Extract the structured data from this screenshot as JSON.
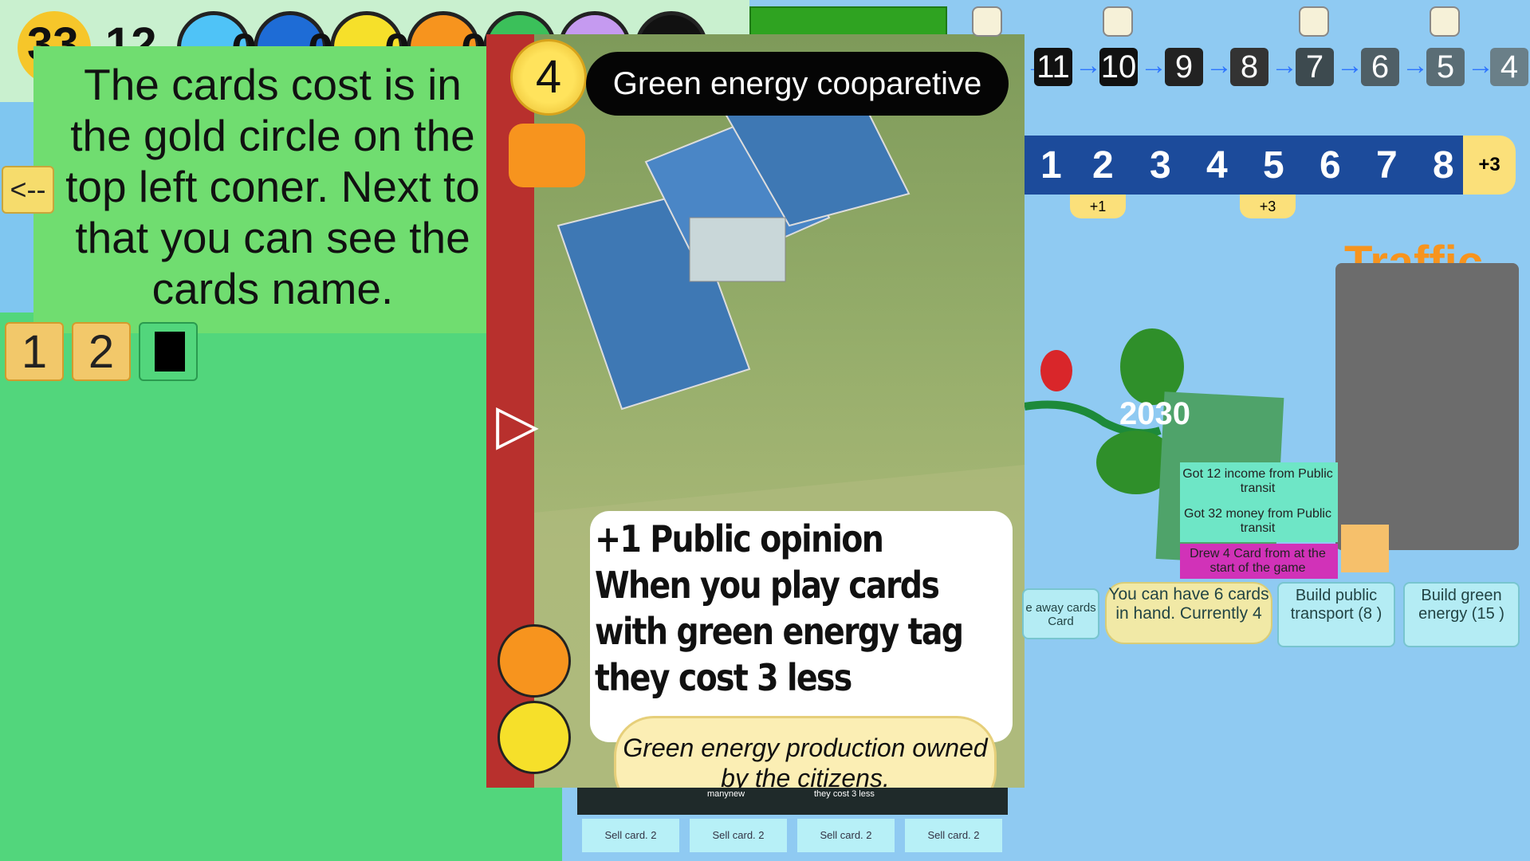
{
  "top_resources": {
    "score": "33",
    "money": "12",
    "zero1": "0",
    "zero2": "0",
    "zero3": "0",
    "zero4": "0"
  },
  "tutorial": {
    "text": "The cards  cost is in the gold circle on the top left coner. Next to that you can see the cards name.",
    "prev_label": "<--",
    "next_label": "-->"
  },
  "pages": {
    "p1": "1",
    "p2": "2"
  },
  "card": {
    "cost": "4",
    "title": "Green energy cooparetive",
    "effect_lines": [
      "+1 Public opinion",
      "When you play  cards",
      "with  green energy tag",
      "they cost 3 less"
    ],
    "flavor": "Green energy production owned by the citizens."
  },
  "track": {
    "numbers": [
      "11",
      "10",
      "9",
      "8",
      "7",
      "6",
      "5",
      "4"
    ]
  },
  "number_track": {
    "numbers": [
      "1",
      "2",
      "3",
      "4",
      "5",
      "6",
      "7",
      "8"
    ],
    "end_label": "+3",
    "bonus1": "+1",
    "bonus2": "+3"
  },
  "map": {
    "year": "2030",
    "traffic_title": "Traffic"
  },
  "log": [
    "Got 12 income from Public transit",
    "Got 32 money from Public transit",
    "Drew 4 Card from at the start of the game"
  ],
  "actions": {
    "throw_away": "e away cards  Card",
    "hand_limit": "You can have 6 cards in hand. Currently 4",
    "build_transport": "Build  public transport (8 )",
    "build_green": "Build  green energy (15 )"
  },
  "hand": {
    "sell_labels": [
      "Sell card. 2",
      "Sell card. 2",
      "Sell card. 2",
      "Sell card. 2"
    ],
    "mini_texts": [
      "manynew",
      "they cost 3  less"
    ]
  },
  "colors": {
    "sky": "#8fcaf2",
    "left_panel": "#52d67c",
    "tutorial_bg": "#70dd70",
    "card_red": "#b8302d",
    "gold": "#ffe35c"
  }
}
